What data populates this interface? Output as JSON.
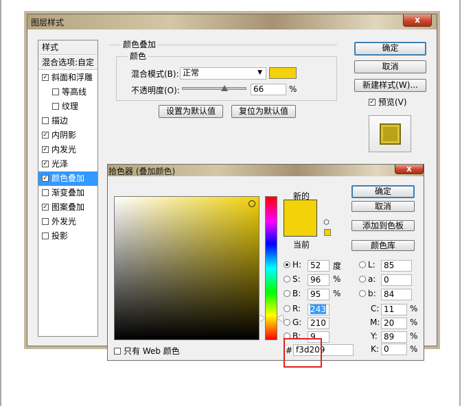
{
  "layer_style": {
    "title": "图层样式",
    "close_glyph": "x",
    "style_list": {
      "header": "样式",
      "blend_options": "混合选项:自定",
      "items": [
        {
          "label": "斜面和浮雕",
          "checked": true
        },
        {
          "label": "等高线",
          "checked": false
        },
        {
          "label": "纹理",
          "checked": false
        },
        {
          "label": "描边",
          "checked": false
        },
        {
          "label": "内阴影",
          "checked": true
        },
        {
          "label": "内发光",
          "checked": true
        },
        {
          "label": "光泽",
          "checked": true
        },
        {
          "label": "颜色叠加",
          "checked": true
        },
        {
          "label": "渐变叠加",
          "checked": false
        },
        {
          "label": "图案叠加",
          "checked": true
        },
        {
          "label": "外发光",
          "checked": false
        },
        {
          "label": "投影",
          "checked": false
        }
      ]
    },
    "overlay": {
      "group_title": "颜色叠加",
      "sub_title": "颜色",
      "blend_mode_label": "混合模式(B):",
      "blend_mode_value": "正常",
      "swatch_color": "#f3d209",
      "opacity_label": "不透明度(O):",
      "opacity_value": "66",
      "opacity_unit": "%",
      "opacity_fraction": 0.66,
      "set_default_button": "设置为默认值",
      "reset_default_button": "复位为默认值"
    },
    "buttons": {
      "ok": "确定",
      "cancel": "取消",
      "new_style": "新建样式(W)...",
      "preview_label": "预览(V)",
      "preview_checked": true
    }
  },
  "color_picker": {
    "title": "拾色器 (叠加颜色)",
    "close_glyph": "x",
    "new_label": "新的",
    "current_label": "当前",
    "new_color": "#f3d209",
    "current_color": "#f3d209",
    "buttons": {
      "ok": "确定",
      "cancel": "取消",
      "add_to_swatches": "添加到色板",
      "color_libraries": "颜色库"
    },
    "web_only_label": "只有 Web 颜色",
    "hsb": {
      "h_label": "H:",
      "h_value": "52",
      "h_unit": "度",
      "s_label": "S:",
      "s_value": "96",
      "s_unit": "%",
      "b_label": "B:",
      "b_value": "95",
      "b_unit": "%"
    },
    "rgb": {
      "r_label": "R:",
      "r_value": "243",
      "g_label": "G:",
      "g_value": "210",
      "b_label": "B:",
      "b_value": "9"
    },
    "lab": {
      "l_label": "L:",
      "l_value": "85",
      "a_label": "a:",
      "a_value": "0",
      "b_label": "b:",
      "b_value": "84"
    },
    "cmyk": {
      "c_label": "C:",
      "c_value": "11",
      "c_unit": "%",
      "m_label": "M:",
      "m_value": "20",
      "m_unit": "%",
      "y_label": "Y:",
      "y_value": "89",
      "y_unit": "%",
      "k_label": "K:",
      "k_value": "0",
      "k_unit": "%"
    },
    "hex_label": "#",
    "hex_value": "f3d209"
  }
}
